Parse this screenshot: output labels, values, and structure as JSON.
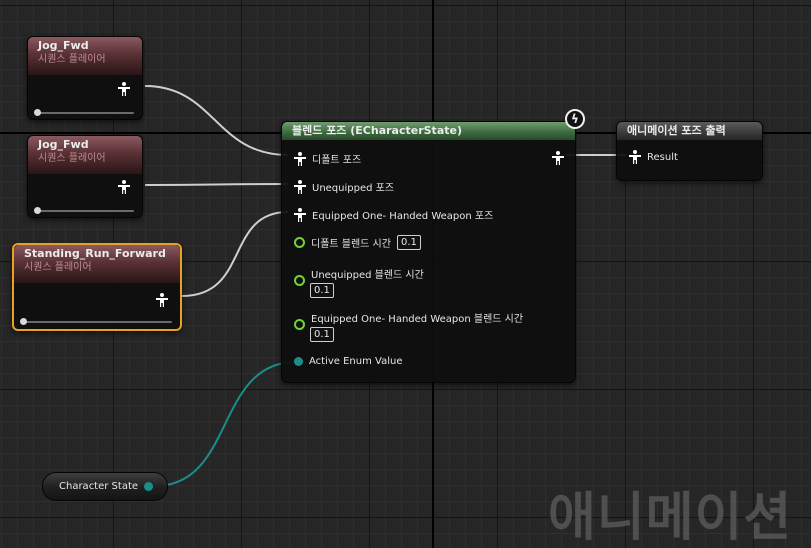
{
  "nodes": {
    "seq1": {
      "title": "Jog_Fwd",
      "subtitle": "시퀀스 플레이어"
    },
    "seq2": {
      "title": "Jog_Fwd",
      "subtitle": "시퀀스 플레이어"
    },
    "seq3": {
      "title": "Standing_Run_Forward",
      "subtitle": "시퀀스 플레이어"
    },
    "blend": {
      "title": "블렌드 포즈 (ECharacterState)",
      "pose_pins": [
        "디폴트 포즈",
        "Unequipped 포즈",
        "Equipped One- Handed Weapon 포즈"
      ],
      "blend_times": [
        {
          "label": "디폴트 블렌드 시간",
          "value": "0.1"
        },
        {
          "label": "Unequipped 블렌드 시간",
          "value": "0.1"
        },
        {
          "label": "Equipped One- Handed Weapon 블렌드 시간",
          "value": "0.1"
        }
      ],
      "enum_pin": "Active Enum Value"
    },
    "output": {
      "title": "애니메이션 포즈 출력",
      "result": "Result"
    },
    "variable": {
      "label": "Character State"
    }
  },
  "watermark": "애니메이션",
  "colors": {
    "sequence_header": "#5a3136",
    "blend_header": "#3b683e",
    "selected_outline": "#e7a223",
    "float_pin": "#74d13a",
    "enum_pin": "#1a8f89",
    "exec_wire": "#cfcfcf"
  },
  "icons": {
    "pose": "pose-person-icon",
    "fast_path": "lightning-icon"
  }
}
